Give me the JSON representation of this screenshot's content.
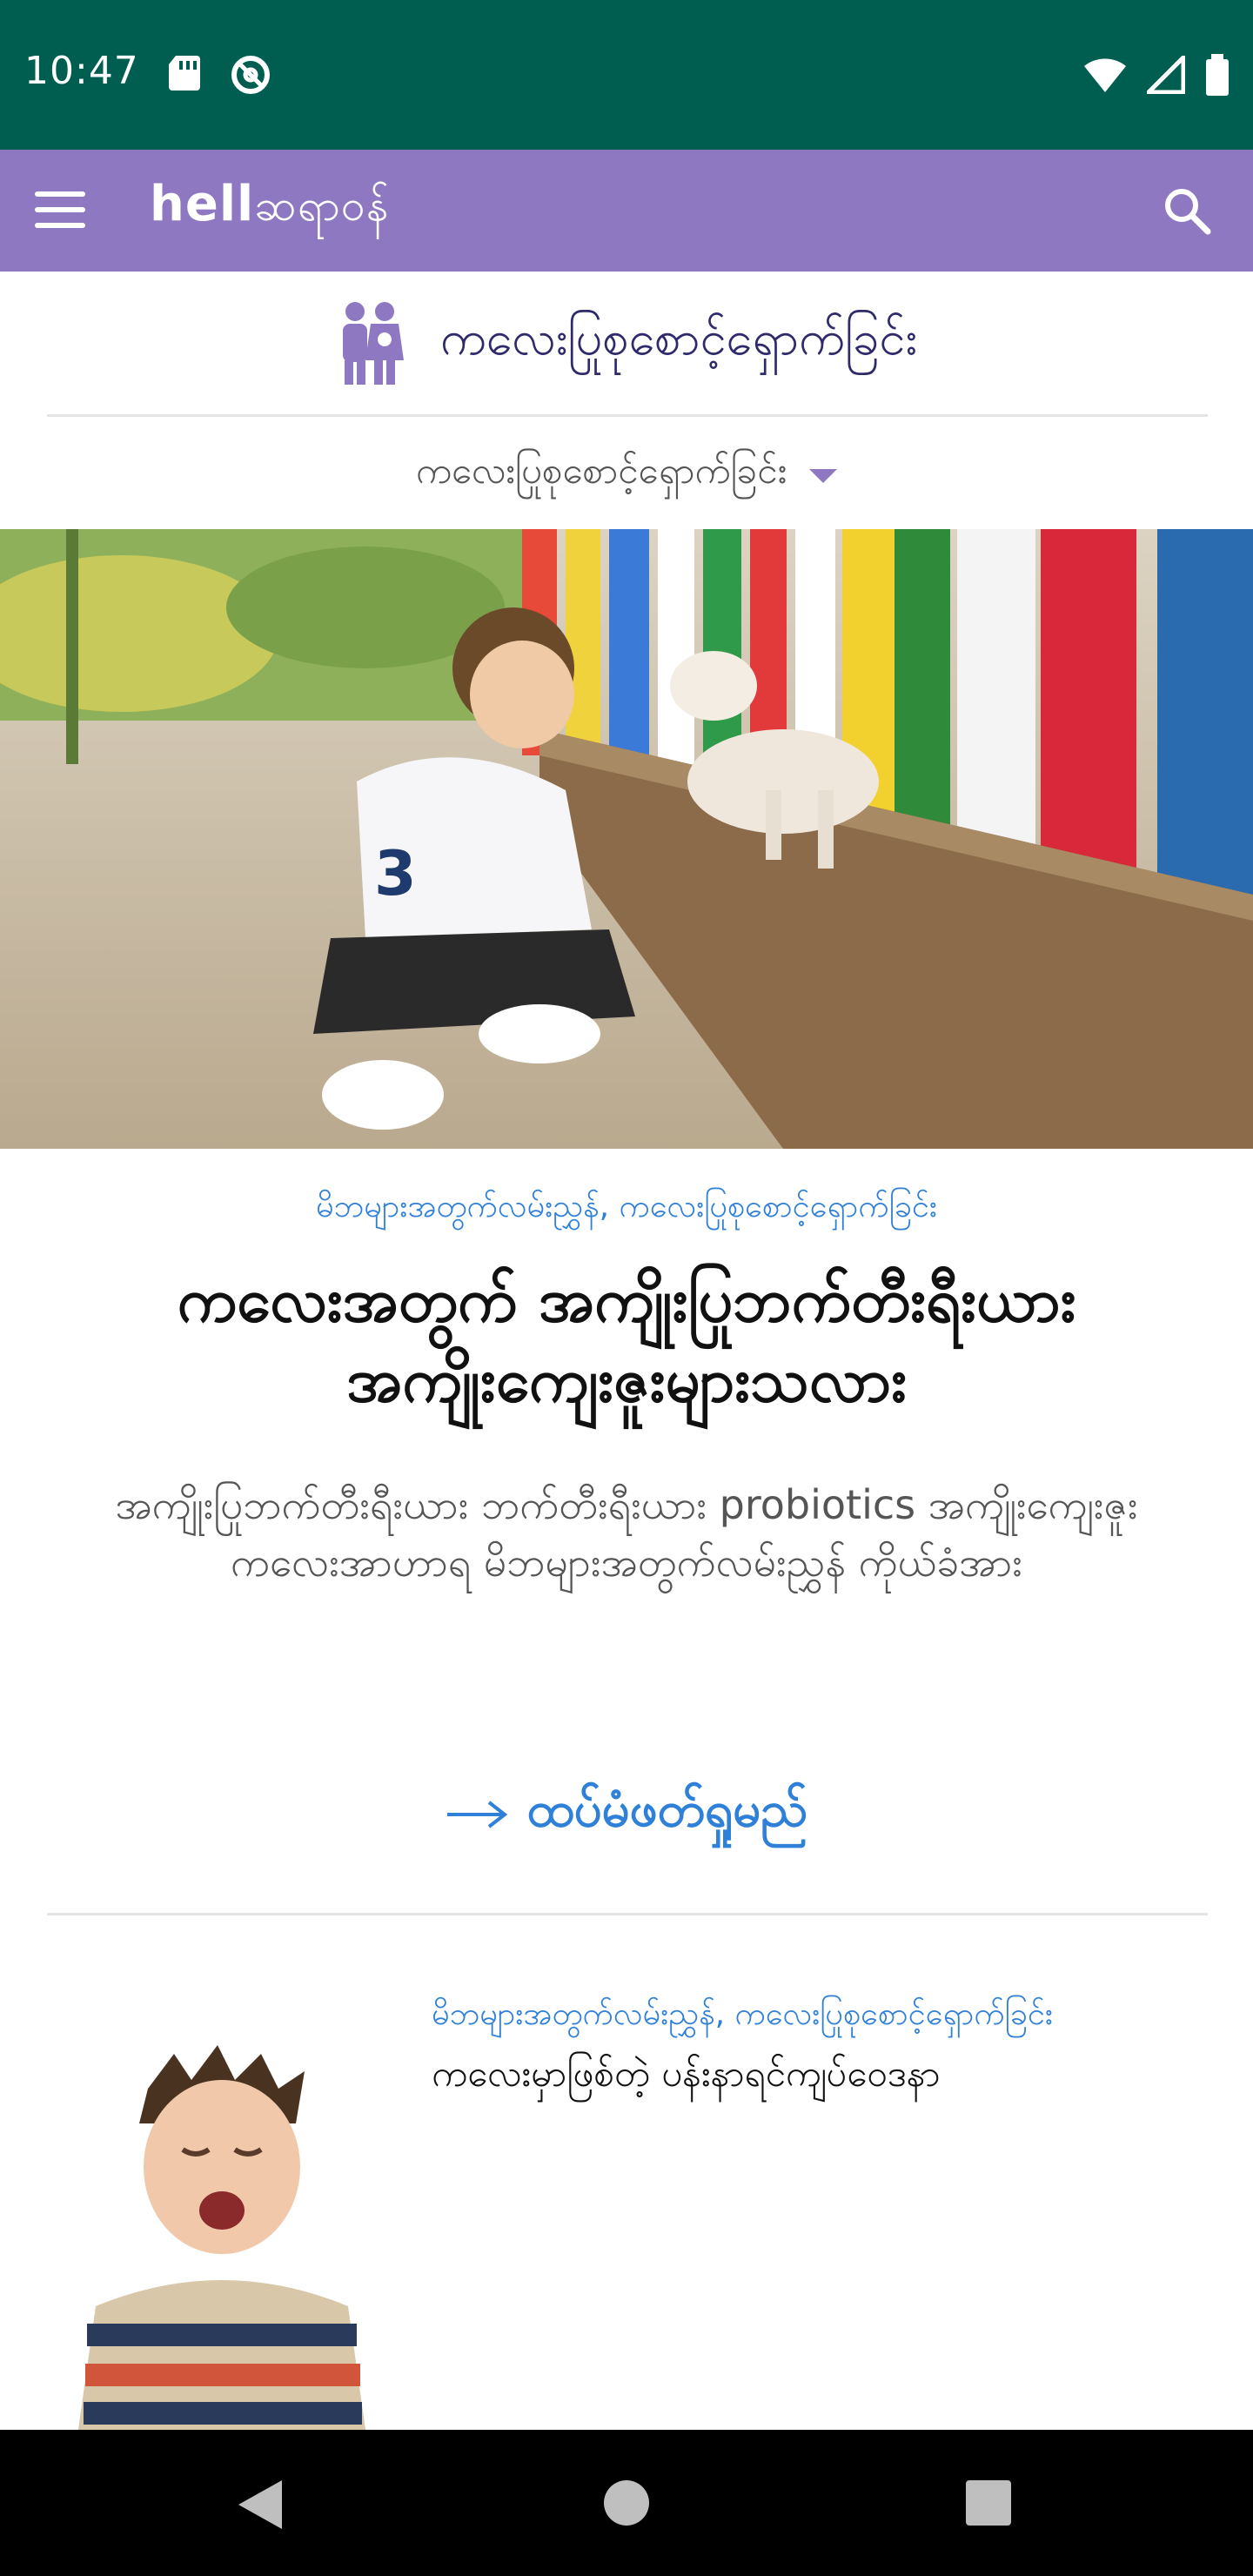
{
  "status_bar": {
    "time": "10:47",
    "left_icons": [
      "sd-card-icon",
      "no-disturb-icon"
    ],
    "right_icons": [
      "wifi-icon",
      "cell-signal-icon",
      "battery-icon"
    ]
  },
  "app_bar": {
    "logo_text": "hell",
    "logo_script": "ဆရာဝန်",
    "menu_icon": "hamburger-menu-icon",
    "search_icon": "search-icon"
  },
  "category": {
    "icon": "parent-child-icon",
    "title": "ကလေးပြုစုစောင့်ရှောက်ခြင်း"
  },
  "subcategory": {
    "selected": "ကလေးပြုစုစောင့်ရှောက်ခြင်း"
  },
  "hero_article": {
    "image_desc": "boy-with-goat-photo",
    "tags": "မိဘများအတွက်လမ်းညွှန်, ကလေးပြုစုစောင့်ရှောက်ခြင်း",
    "title": "ကလေးအတွက် အကျိုးပြုဘက်တီးရီးယား အကျိုးကျေးဇူးများသလား",
    "description": "အကျိုးပြုဘက်တီးရီးယား ဘက်တီးရီးယား probiotics အကျိုးကျေးဇူး ကလေးအာဟာရ မိဘများအတွက်လမ်းညွှန် ကိုယ်ခံအား",
    "read_more": "ထပ်မံဖတ်ရှုမည်"
  },
  "second_article": {
    "image_desc": "yawning-boy-photo",
    "tags": "မိဘများအတွက်လမ်းညွှန်, ကလေးပြုစုစောင့်ရှောက်ခြင်း",
    "title": "ကလေးမှာဖြစ်တဲ့ ပန်းနာရင်ကျပ်ဝေဒနာ"
  },
  "colors": {
    "status_bar": "#005e50",
    "app_bar": "#8e78c2",
    "link_blue": "#2f80d8",
    "title_dark": "#2e2a6b"
  }
}
